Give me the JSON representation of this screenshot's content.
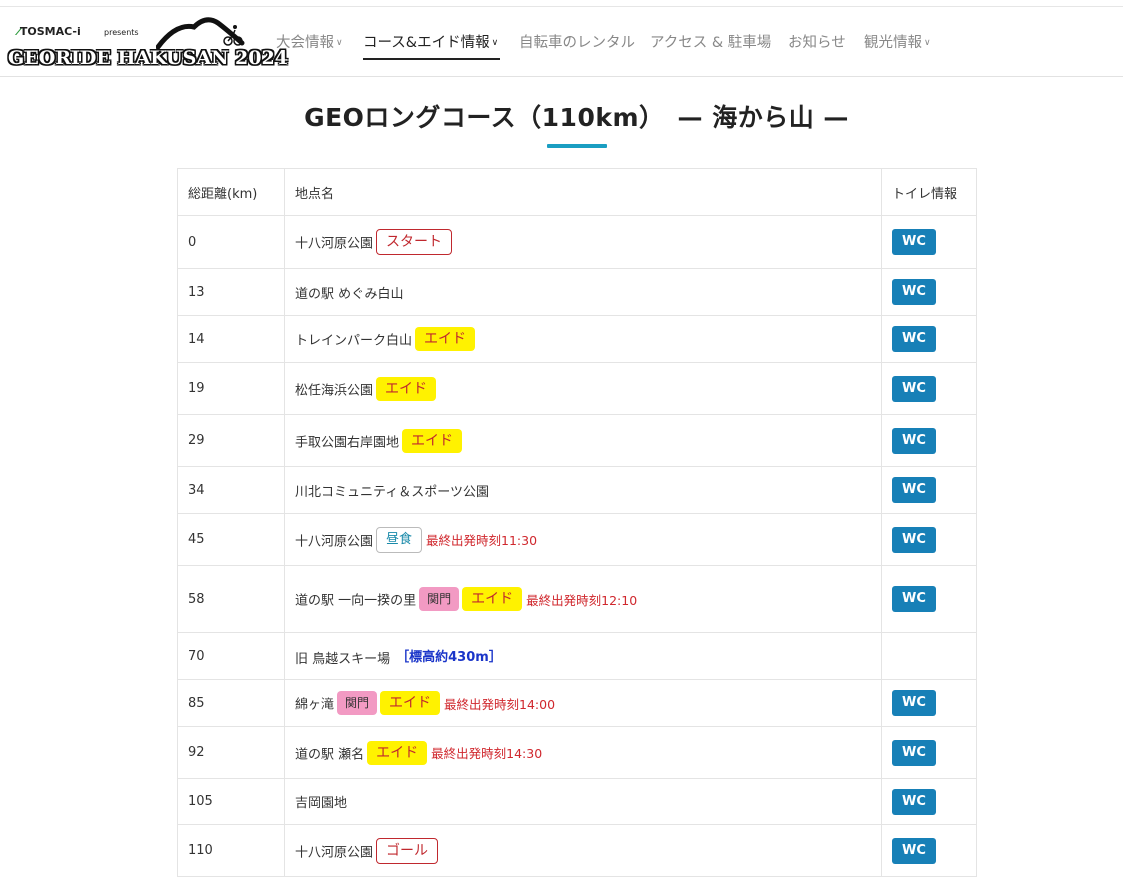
{
  "header": {
    "sponsor": "TOSMAC-i",
    "presents": "presents",
    "event_name": "GEORIDE HAKUSAN 2024",
    "nav": [
      {
        "label": "大会情報",
        "dropdown": true,
        "active": false
      },
      {
        "label": "コース&エイド情報",
        "dropdown": true,
        "active": true
      },
      {
        "label": "自転車のレンタル",
        "dropdown": false,
        "active": false
      },
      {
        "label": "アクセス & 駐車場",
        "dropdown": false,
        "active": false
      },
      {
        "label": "お知らせ",
        "dropdown": false,
        "active": false
      },
      {
        "label": "観光情報",
        "dropdown": true,
        "active": false
      }
    ]
  },
  "page": {
    "title": "GEOロングコース（110km）　— 海から山 —"
  },
  "table": {
    "headers": [
      "総距離(km)",
      "地点名",
      "トイレ情報"
    ],
    "rows": [
      {
        "km": "0",
        "name": "十八河原公園",
        "tags": [
          {
            "type": "start",
            "label": "スタート"
          }
        ],
        "deadline": "",
        "elevation": "",
        "wc": "WC"
      },
      {
        "km": "13",
        "name": "道の駅 めぐみ白山",
        "tags": [],
        "deadline": "",
        "elevation": "",
        "wc": "WC"
      },
      {
        "km": "14",
        "name": "トレインパーク白山",
        "tags": [
          {
            "type": "aid",
            "label": "エイド"
          }
        ],
        "deadline": "",
        "elevation": "",
        "wc": "WC"
      },
      {
        "km": "19",
        "name": "松任海浜公園",
        "tags": [
          {
            "type": "aid",
            "label": "エイド"
          }
        ],
        "deadline": "",
        "elevation": "",
        "wc": "WC"
      },
      {
        "km": "29",
        "name": "手取公園右岸園地",
        "tags": [
          {
            "type": "aid",
            "label": "エイド"
          }
        ],
        "deadline": "",
        "elevation": "",
        "wc": "WC"
      },
      {
        "km": "34",
        "name": "川北コミュニティ＆スポーツ公園",
        "tags": [],
        "deadline": "",
        "elevation": "",
        "wc": "WC"
      },
      {
        "km": "45",
        "name": "十八河原公園",
        "tags": [
          {
            "type": "lunch",
            "label": "昼食"
          }
        ],
        "deadline": "最終出発時刻11:30",
        "elevation": "",
        "wc": "WC"
      },
      {
        "km": "58",
        "name": "道の駅 一向一揆の里",
        "tags": [
          {
            "type": "gate",
            "label": "関門"
          },
          {
            "type": "aid",
            "label": "エイド"
          }
        ],
        "deadline": "最終出発時刻12:10",
        "elevation": "",
        "wc": "WC"
      },
      {
        "km": "70",
        "name": "旧 鳥越スキー場",
        "tags": [],
        "deadline": "",
        "elevation": "［標高約430m］",
        "wc": ""
      },
      {
        "km": "85",
        "name": "綿ヶ滝",
        "tags": [
          {
            "type": "gate",
            "label": "関門"
          },
          {
            "type": "aid",
            "label": "エイド"
          }
        ],
        "deadline": "最終出発時刻14:00",
        "elevation": "",
        "wc": "WC"
      },
      {
        "km": "92",
        "name": "道の駅 瀬名",
        "tags": [
          {
            "type": "aid",
            "label": "エイド"
          }
        ],
        "deadline": "最終出発時刻14:30",
        "elevation": "",
        "wc": "WC"
      },
      {
        "km": "105",
        "name": "吉岡園地",
        "tags": [],
        "deadline": "",
        "elevation": "",
        "wc": "WC"
      },
      {
        "km": "110",
        "name": "十八河原公園",
        "tags": [
          {
            "type": "goal",
            "label": "ゴール"
          }
        ],
        "deadline": "",
        "elevation": "",
        "wc": "WC"
      }
    ]
  },
  "colors": {
    "accent": "#1a9ec2",
    "wc_button": "#1780b7",
    "aid_tag": "#fff200",
    "gate_tag": "#f29ac3",
    "deadline_text": "#d0282e",
    "elevation_text": "#1a35c9"
  }
}
